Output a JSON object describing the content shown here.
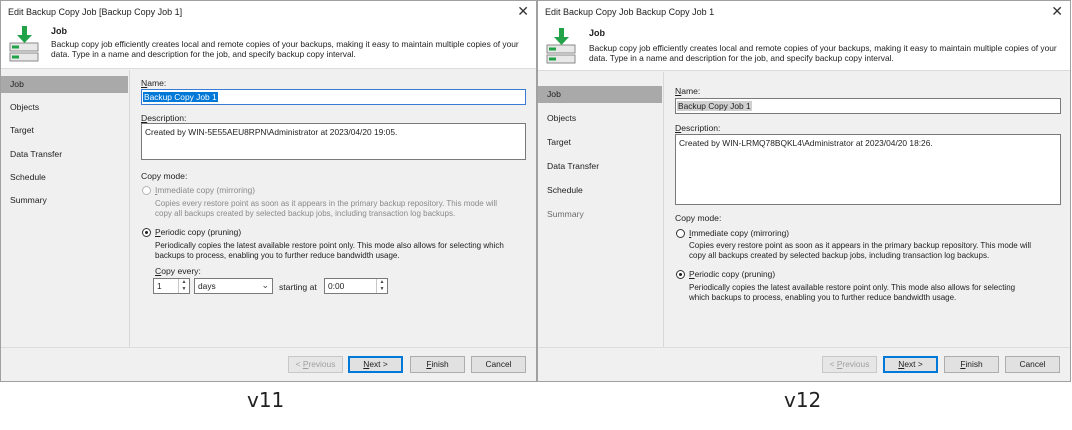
{
  "windows": {
    "v11": {
      "title": "Edit Backup Copy Job [Backup Copy Job 1]",
      "header_title": "Job",
      "header_desc_line1": "Backup copy job efficiently creates local and remote copies of your backups, making it easy to maintain multiple copies of your",
      "header_desc_line2": "data. Type in a name and description for the job, and specify backup copy interval.",
      "nav": [
        "Job",
        "Objects",
        "Target",
        "Data Transfer",
        "Schedule",
        "Summary"
      ],
      "name_label": "Name:",
      "name_value": "Backup Copy Job 1",
      "description_label": "Description:",
      "description_value": "Created by WIN-5E55AEU8RPN\\Administrator at 2023/04/20 19:05.",
      "copy_mode_label": "Copy mode:",
      "immediate_label": "Immediate copy (mirroring)",
      "immediate_desc_line1": "Copies every restore point as soon as it appears in the primary backup repository. This mode will",
      "immediate_desc_line2": "copy all backups created by selected backup jobs, including transaction log backups.",
      "periodic_label": "Periodic copy (pruning)",
      "periodic_desc_line1": "Periodically copies the latest available restore point only. This mode also allows for selecting which",
      "periodic_desc_line2": "backups to process, enabling you to further reduce bandwidth usage.",
      "copy_every_label": "Copy every:",
      "copy_every_value": "1",
      "copy_every_unit": "days",
      "starting_at_label": "starting at",
      "starting_at_value": "0:00",
      "buttons": {
        "previous": "< Previous",
        "next": "Next >",
        "finish": "Finish",
        "cancel": "Cancel"
      },
      "caption": "v11"
    },
    "v12": {
      "title": "Edit Backup Copy Job Backup Copy Job 1",
      "header_title": "Job",
      "header_desc_line1": "Backup copy job efficiently creates local and remote copies of your backups, making it easy to maintain multiple copies of your",
      "header_desc_line2": "data. Type in a name and description for the job, and specify backup copy interval.",
      "nav": [
        "Job",
        "Objects",
        "Target",
        "Data Transfer",
        "Schedule",
        "Summary"
      ],
      "name_label": "Name:",
      "name_value": "Backup Copy Job 1",
      "description_label": "Description:",
      "description_value": "Created by WIN-LRMQ78BQKL4\\Administrator at 2023/04/20 18:26.",
      "copy_mode_label": "Copy mode:",
      "immediate_label": "Immediate copy (mirroring)",
      "immediate_desc_line1": "Copies every restore point as soon as it appears in the primary backup repository. This mode will",
      "immediate_desc_line2": "copy all backups created by selected backup jobs, including transaction log backups.",
      "periodic_label": "Periodic copy (pruning)",
      "periodic_desc_line1": "Periodically copies the latest available restore point only. This mode also allows for selecting",
      "periodic_desc_line2": "which backups to process, enabling you to further reduce bandwidth usage.",
      "buttons": {
        "previous": "< Previous",
        "next": "Next >",
        "finish": "Finish",
        "cancel": "Cancel"
      },
      "caption": "v12"
    }
  }
}
